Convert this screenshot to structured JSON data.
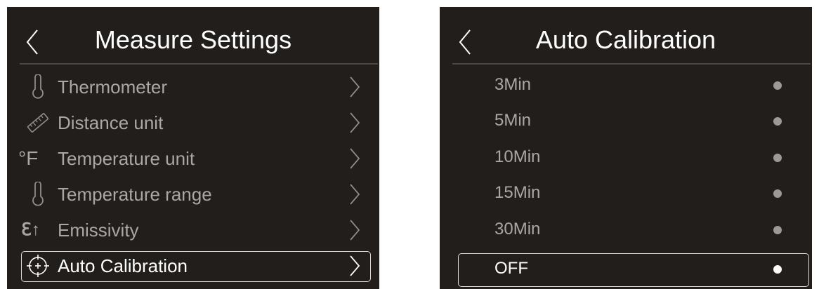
{
  "measure_settings": {
    "title": "Measure Settings",
    "items": [
      {
        "label": "Thermometer",
        "icon": "thermometer-icon"
      },
      {
        "label": "Distance unit",
        "icon": "ruler-icon"
      },
      {
        "label": "Temperature unit",
        "icon": "fahrenheit-icon",
        "icon_text": "°F"
      },
      {
        "label": "Temperature range",
        "icon": "thermometer-icon"
      },
      {
        "label": "Emissivity",
        "icon": "emissivity-icon",
        "icon_text": "ℇ↑"
      },
      {
        "label": "Auto Calibration",
        "icon": "crosshair-icon",
        "selected": true
      }
    ]
  },
  "auto_calibration": {
    "title": "Auto Calibration",
    "options": [
      {
        "label": "3Min"
      },
      {
        "label": "5Min"
      },
      {
        "label": "10Min"
      },
      {
        "label": "15Min"
      },
      {
        "label": "30Min"
      },
      {
        "label": "OFF",
        "selected": true
      }
    ]
  },
  "colors": {
    "screen_background": "#221e1b",
    "text_dim": "#aaa7a4",
    "text_active": "#ffffff",
    "selection_border": "#dcdcdc"
  }
}
